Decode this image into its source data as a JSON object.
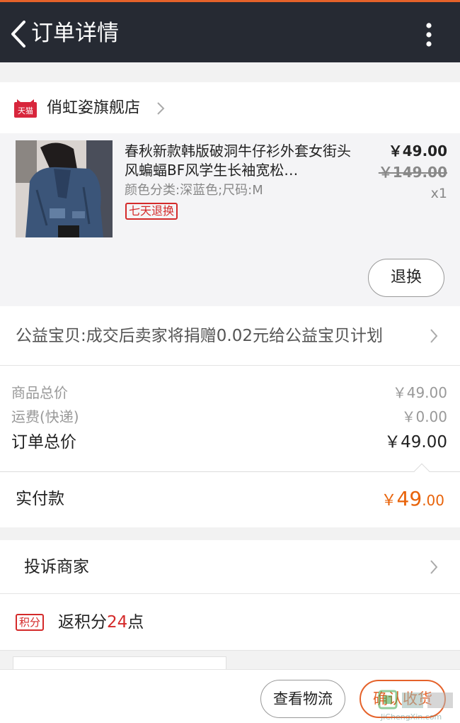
{
  "header": {
    "title": "订单详情",
    "back_icon": "chevron-left-icon",
    "menu_icon": "more-vertical-icon"
  },
  "shop": {
    "name": "俏虹姿旗舰店",
    "logo_text": "天猫"
  },
  "item": {
    "title": "春秋新款韩版破洞牛仔衫外套女街头风蝙蝠BF风学生长袖宽松…",
    "spec": "颜色分类:深蓝色;尺码:M",
    "badge": "七天退换",
    "price": "￥49.00",
    "original_price": "￥149.00",
    "quantity": "x1",
    "exchange_button": "退换"
  },
  "charity": {
    "text": "公益宝贝:成交后卖家将捐赠0.02元给公益宝贝计划"
  },
  "summary": {
    "goods_label": "商品总价",
    "goods_value": "￥49.00",
    "shipping_label": "运费(快递)",
    "shipping_value": "￥0.00",
    "total_label": "订单总价",
    "total_value": "￥49.00"
  },
  "payment": {
    "label": "实付款",
    "symbol": "￥",
    "integer": "49",
    "decimal": ".00"
  },
  "complain": {
    "label": "投诉商家"
  },
  "points": {
    "badge": "积分",
    "prefix": "返积分",
    "value": "24",
    "suffix": "点"
  },
  "actions": {
    "logistics": "查看物流",
    "confirm": "确认收货"
  },
  "watermark": "JiChengXin.com",
  "colors": {
    "accent": "#e5622a",
    "header_bg": "#262a33",
    "badge_red": "#d42a2a",
    "price_orange": "#e8630a"
  }
}
